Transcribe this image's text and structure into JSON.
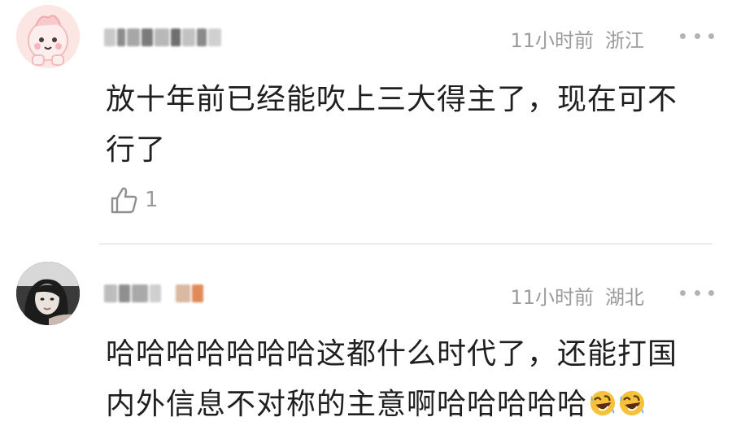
{
  "comments": [
    {
      "time": "11小时前",
      "location": "浙江",
      "text_lines": [
        "放十年前已经能吹上三大得主了，现在可不",
        "行了"
      ],
      "likes": "1",
      "icons": {
        "avatar": "cartoon-avatar",
        "more": "more-dots-icon",
        "like": "thumbs-up-icon"
      }
    },
    {
      "time": "11小时前",
      "location": "湖北",
      "text_lines": [
        "哈哈哈哈哈哈哈这都什么时代了，还能打国",
        "内外信息不对称的主意啊哈哈哈哈哈"
      ],
      "icons": {
        "avatar": "photo-avatar",
        "more": "more-dots-icon",
        "emoji": "rolling-laughing-emoji"
      }
    }
  ],
  "colors": {
    "meta_text": "#9b9b9b",
    "body_text": "#1f1f1f",
    "divider": "#ececec",
    "dots": "#b3b3b3"
  }
}
